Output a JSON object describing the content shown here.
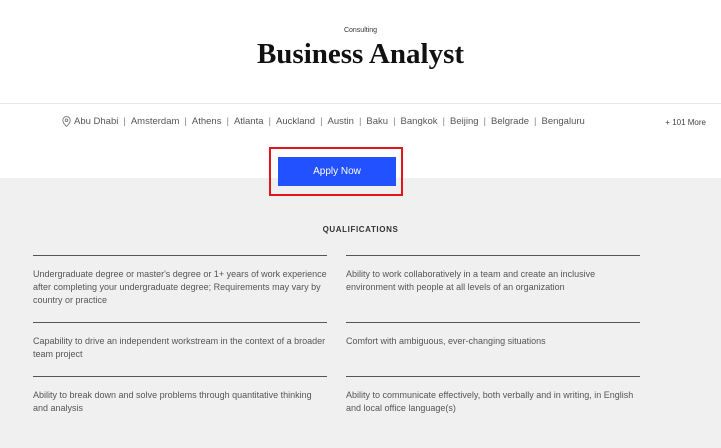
{
  "header": {
    "category": "Consulting",
    "title": "Business Analyst"
  },
  "locations": {
    "icon": "location-pin-icon",
    "items": [
      "Abu Dhabi",
      "Amsterdam",
      "Athens",
      "Atlanta",
      "Auckland",
      "Austin",
      "Baku",
      "Bangkok",
      "Beijing",
      "Belgrade",
      "Bengaluru"
    ],
    "separator": "|",
    "more": "+ 101 More"
  },
  "apply": {
    "label": "Apply Now",
    "color": "#2251ff",
    "highlight_color": "#e0161c"
  },
  "qualifications": {
    "heading": "QUALIFICATIONS",
    "items": [
      "Undergraduate degree or master's degree or 1+ years of work experience after completing your undergraduate degree; Requirements may vary by country or practice",
      "Ability to work collaboratively in a team and create an inclusive environment with people at all levels of an organization",
      "Capability to drive an independent workstream in the context of a broader team project",
      "Comfort with ambiguous, ever-changing situations",
      "Ability to break down and solve problems through quantitative thinking and analysis",
      "Ability to communicate effectively, both verbally and in writing, in English and local office language(s)"
    ]
  }
}
